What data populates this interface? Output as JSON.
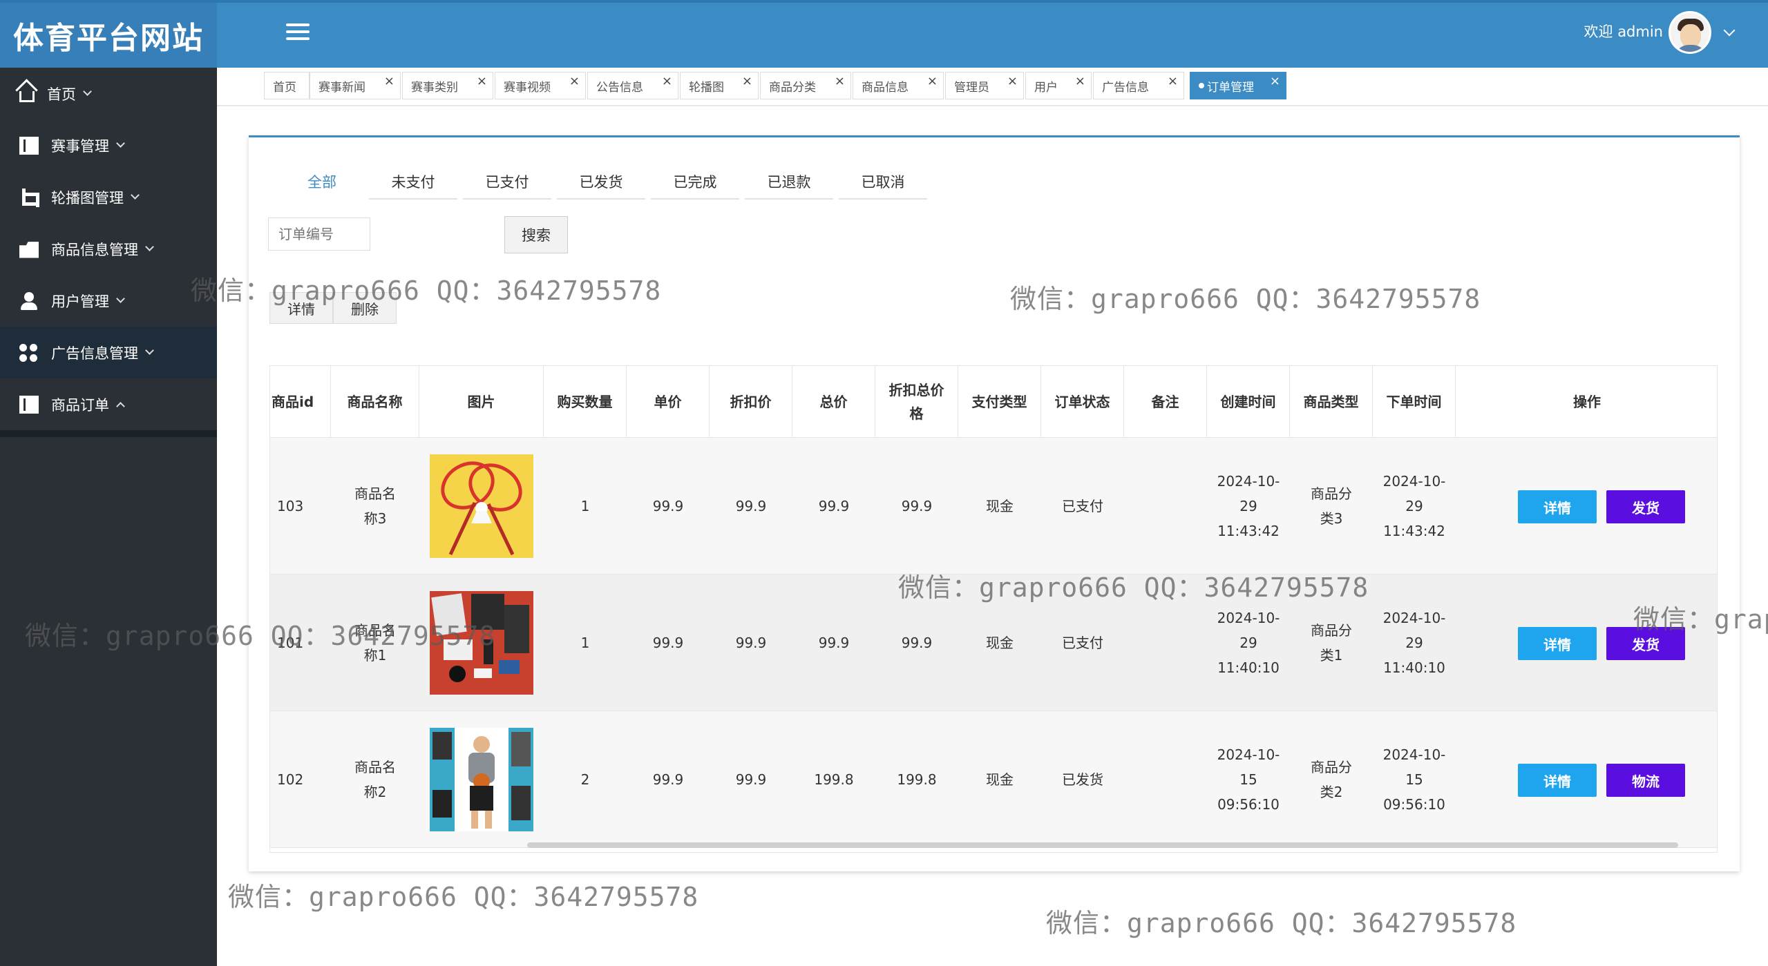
{
  "header": {
    "brand": "体育平台网站",
    "welcome": "欢迎 admin"
  },
  "sidebar": {
    "items": [
      {
        "label": "首页",
        "icon": "home-icon"
      },
      {
        "label": "赛事管理",
        "icon": "book-icon"
      },
      {
        "label": "轮播图管理",
        "icon": "crop-icon"
      },
      {
        "label": "商品信息管理",
        "icon": "folder-icon"
      },
      {
        "label": "用户管理",
        "icon": "user-icon"
      },
      {
        "label": "广告信息管理",
        "icon": "grid-icon"
      },
      {
        "label": "商品订单",
        "icon": "book-icon"
      }
    ]
  },
  "tabs": [
    {
      "label": "首页"
    },
    {
      "label": "赛事新闻"
    },
    {
      "label": "赛事类别"
    },
    {
      "label": "赛事视频"
    },
    {
      "label": "公告信息"
    },
    {
      "label": "轮播图"
    },
    {
      "label": "商品分类"
    },
    {
      "label": "商品信息"
    },
    {
      "label": "管理员"
    },
    {
      "label": "用户"
    },
    {
      "label": "广告信息"
    },
    {
      "label": "订单管理"
    }
  ],
  "close_glyph": "×",
  "status_tabs": [
    "全部",
    "未支付",
    "已支付",
    "已发货",
    "已完成",
    "已退款",
    "已取消"
  ],
  "search": {
    "placeholder": "订单编号",
    "button": "搜索"
  },
  "actions": {
    "detail": "详情",
    "delete": "删除"
  },
  "table": {
    "headers": [
      "商品id",
      "商品名称",
      "图片",
      "购买数量",
      "单价",
      "折扣价",
      "总价",
      "折扣总价格",
      "支付类型",
      "订单状态",
      "备注",
      "创建时间",
      "商品类型",
      "下单时间",
      "操作"
    ],
    "rows": [
      {
        "id": "103",
        "name": "商品名称3",
        "image": "badminton-racket-image",
        "qty": "1",
        "price": "99.9",
        "discount": "99.9",
        "total": "99.9",
        "discount_total": "99.9",
        "pay_type": "现金",
        "status": "已支付",
        "note": "",
        "created": "2024-10-29 11:43:42",
        "category": "商品分类3",
        "ordered": "2024-10-29 11:43:42",
        "btn1": "详情",
        "btn2": "发货"
      },
      {
        "id": "101",
        "name": "商品名称1",
        "image": "sports-gear-image",
        "qty": "1",
        "price": "99.9",
        "discount": "99.9",
        "total": "99.9",
        "discount_total": "99.9",
        "pay_type": "现金",
        "status": "已支付",
        "note": "",
        "created": "2024-10-29 11:40:10",
        "category": "商品分类1",
        "ordered": "2024-10-29 11:40:10",
        "btn1": "详情",
        "btn2": "发货"
      },
      {
        "id": "102",
        "name": "商品名称2",
        "image": "basketball-player-image",
        "qty": "2",
        "price": "99.9",
        "discount": "99.9",
        "total": "199.8",
        "discount_total": "199.8",
        "pay_type": "现金",
        "status": "已发货",
        "note": "",
        "created": "2024-10-15 09:56:10",
        "category": "商品分类2",
        "ordered": "2024-10-15 09:56:10",
        "btn1": "详情",
        "btn2": "物流"
      }
    ]
  },
  "watermark": "微信：grapro666 QQ：3642795578",
  "watermark_partial": "微信：grap",
  "colors": {
    "header": "#3b8bc4",
    "sidebar": "#2a3036",
    "detail_button": "#1fa5ee",
    "ship_button": "#5a0fe0"
  }
}
